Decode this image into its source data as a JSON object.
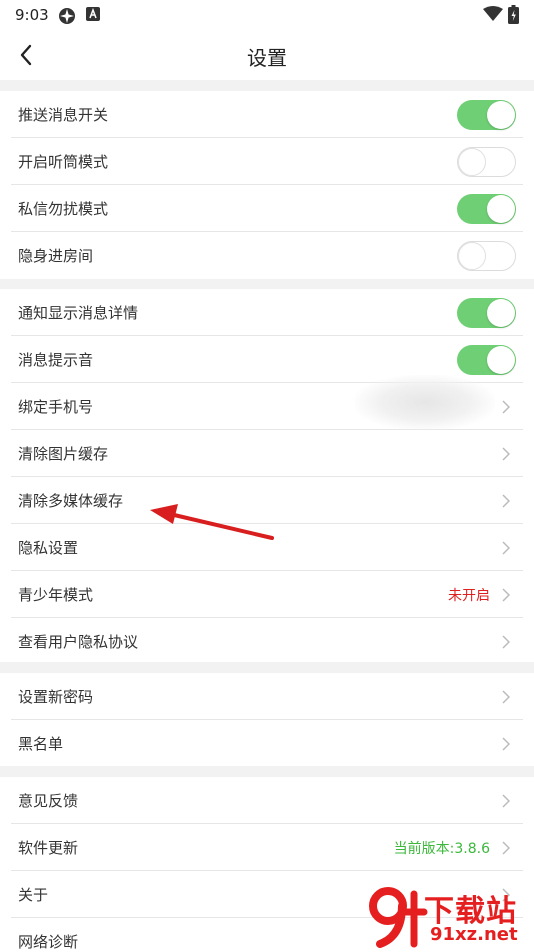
{
  "status_bar": {
    "time": "9:03",
    "icons": [
      "app-icon",
      "a-badge-icon",
      "wifi-icon",
      "battery-icon"
    ]
  },
  "nav": {
    "title": "设置",
    "back_icon": "chevron-left-icon"
  },
  "sections": [
    {
      "items": [
        {
          "label": "推送消息开关",
          "control": "toggle",
          "on": true
        },
        {
          "label": "开启听筒模式",
          "control": "toggle",
          "on": false
        },
        {
          "label": "私信勿扰模式",
          "control": "toggle",
          "on": true
        },
        {
          "label": "隐身进房间",
          "control": "toggle",
          "on": false
        }
      ]
    },
    {
      "items": [
        {
          "label": "通知显示消息详情",
          "control": "toggle",
          "on": true
        },
        {
          "label": "消息提示音",
          "control": "toggle",
          "on": true
        },
        {
          "label": "绑定手机号",
          "control": "chevron"
        },
        {
          "label": "清除图片缓存",
          "control": "chevron"
        },
        {
          "label": "清除多媒体缓存",
          "control": "chevron"
        },
        {
          "label": "隐私设置",
          "control": "chevron"
        },
        {
          "label": "青少年模式",
          "control": "chevron",
          "value": "未开启",
          "value_color": "#e02020"
        },
        {
          "label": "查看用户隐私协议",
          "control": "chevron"
        }
      ]
    },
    {
      "items": [
        {
          "label": "设置新密码",
          "control": "chevron"
        },
        {
          "label": "黑名单",
          "control": "chevron"
        }
      ]
    },
    {
      "items": [
        {
          "label": "意见反馈",
          "control": "chevron"
        },
        {
          "label": "软件更新",
          "control": "chevron",
          "value": "当前版本:3.8.6",
          "value_color": "#3cb83c"
        },
        {
          "label": "关于",
          "control": "chevron"
        },
        {
          "label": "网络诊断",
          "control": "chevron"
        }
      ]
    }
  ],
  "colors": {
    "toggle_on": "#6fcf74",
    "section_gap": "#f2f2f2",
    "annotation_arrow": "#d81e1e"
  },
  "watermark": {
    "logo_text": "9f",
    "title": "下载站",
    "domain": "91xz.net"
  }
}
